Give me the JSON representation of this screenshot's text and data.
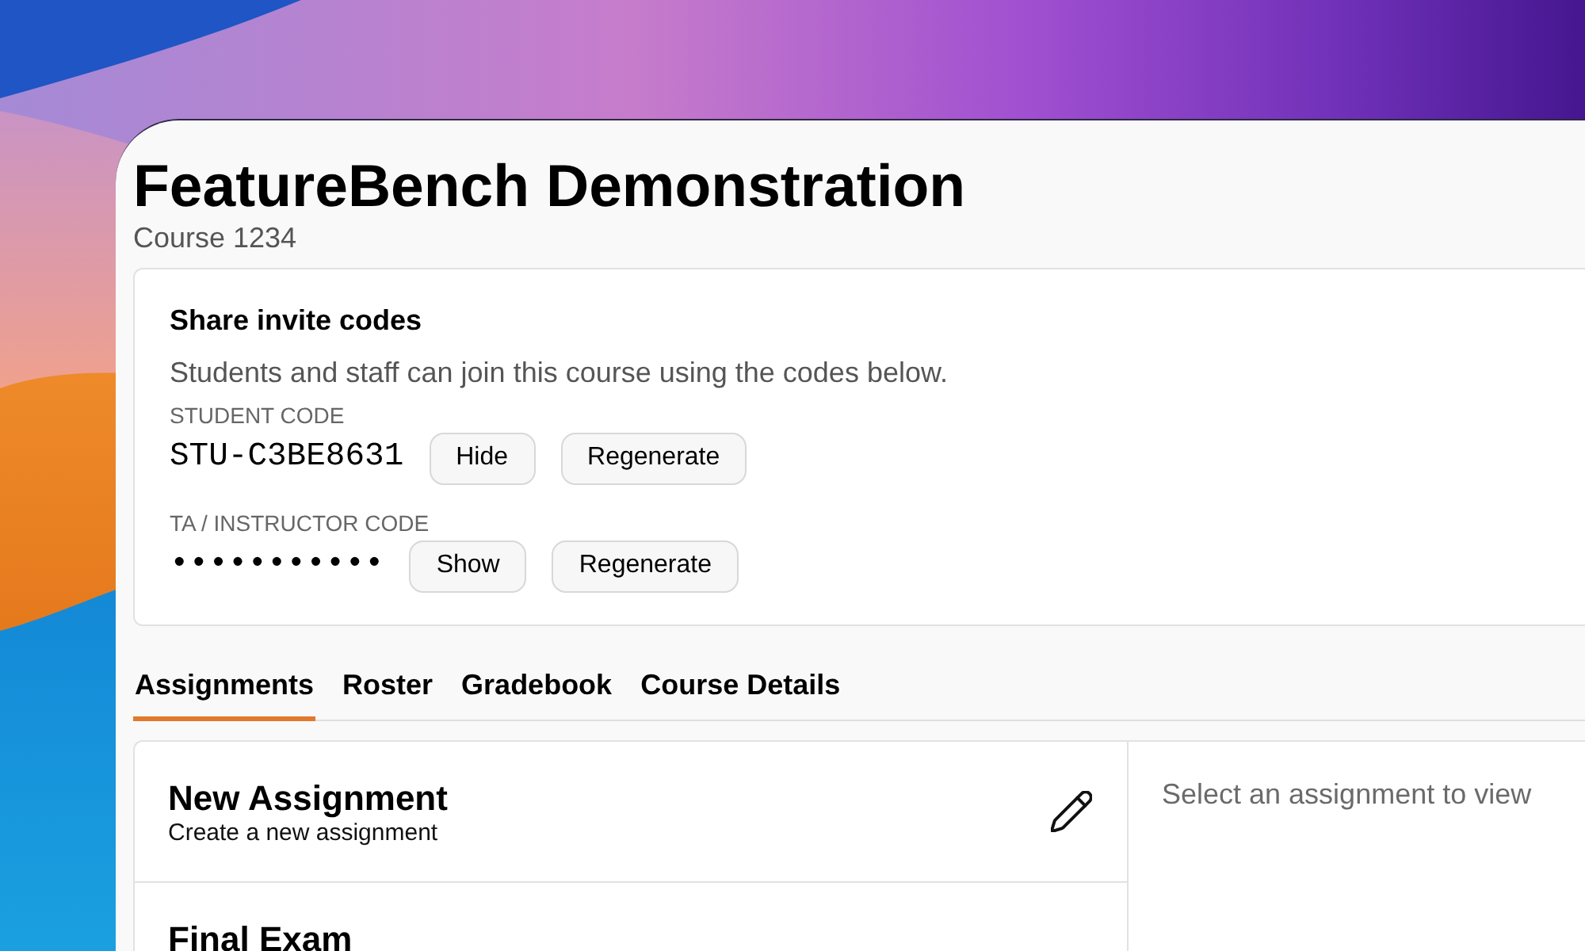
{
  "course": {
    "title": "FeatureBench Demonstration",
    "subtitle": "Course 1234"
  },
  "invite_card": {
    "title": "Share invite codes",
    "description": "Students and staff can join this course using the codes below.",
    "codes": [
      {
        "label": "STUDENT CODE",
        "value": "STU-C3BE8631",
        "buttons": [
          "Hide",
          "Regenerate"
        ]
      },
      {
        "label": "TA / INSTRUCTOR CODE",
        "value": "•••••••••••",
        "buttons": [
          "Show",
          "Regenerate"
        ]
      }
    ]
  },
  "tabs": [
    {
      "label": "Assignments",
      "selected": true
    },
    {
      "label": "Roster",
      "selected": false
    },
    {
      "label": "Gradebook",
      "selected": false
    },
    {
      "label": "Course Details",
      "selected": false
    }
  ],
  "assignments": [
    {
      "kind": "new",
      "title": "New Assignment",
      "subtitle": "Create a new assignment"
    },
    {
      "kind": "item",
      "title": "Final Exam"
    }
  ],
  "detail_panel": {
    "message": "Select an assignment to view"
  }
}
